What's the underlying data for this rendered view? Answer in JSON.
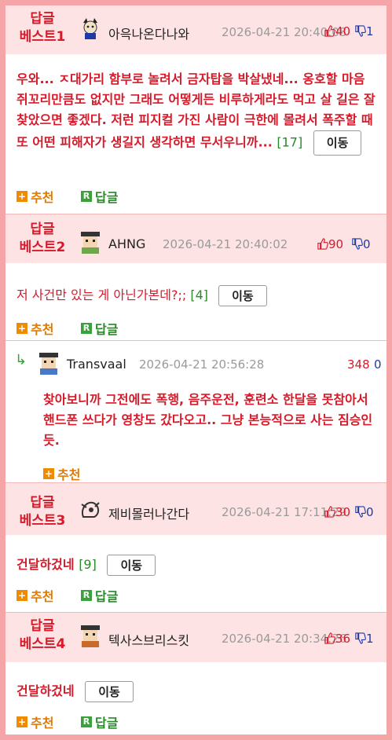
{
  "ui": {
    "best_line1": "답글",
    "move_label": "이동",
    "recommend_label": "추천",
    "reply_label": "답글",
    "plus_glyph": "+",
    "r_glyph": "R"
  },
  "colors": {
    "frame_border": "#f5a5a8",
    "header_bg": "#fde3e4",
    "accent_red": "#d61a2a",
    "down_blue": "#1d3aa5",
    "count_green": "#2a8a2a"
  },
  "comments": [
    {
      "best_line2": "베스트1",
      "nickname": "아윽나온다나와",
      "datetime": "2026-04-21 20:40:08",
      "up": "40",
      "down": "1",
      "body": "우와... ㅈ대가리 함부로 놀려서 금자탑을 박살냈네... 옹호할 마음 쥐꼬리만큼도 없지만 그래도 어떻게든 비루하게라도 먹고 살 길은 잘 찾았으면 좋겠다. 저런 피지컬 가진 사람이 극한에 몰려서 폭주할 때 또 어떤 피해자가 생길지 생각하면 무서우니까...",
      "reply_count": "[17]"
    },
    {
      "best_line2": "베스트2",
      "nickname": "AHNG",
      "datetime": "2026-04-21 20:40:02",
      "up": "90",
      "down": "0",
      "body": "저 사건만 있는 게 아닌가본데?;;",
      "reply_count": "[4]"
    },
    {
      "best_line2": "베스트3",
      "nickname": "제비몰러나간다",
      "datetime": "2026-04-21 17:11:29",
      "up": "30",
      "down": "0",
      "body": "건달하겄네",
      "reply_count": "[9]"
    },
    {
      "best_line2": "베스트4",
      "nickname": "텍사스브리스킷",
      "datetime": "2026-04-21 20:34:26",
      "up": "36",
      "down": "1",
      "body": "건달하겄네",
      "reply_count": ""
    }
  ],
  "reply": {
    "nickname": "Transvaal",
    "datetime": "2026-04-21 20:56:28",
    "up": "348",
    "down": "0",
    "body": "찾아보니까 그전에도 폭행, 음주운전, 훈련소 한달을 못참아서 핸드폰 쓰다가 영창도 갔다오고.. 그냥 본능적으로 사는 짐승인듯."
  }
}
